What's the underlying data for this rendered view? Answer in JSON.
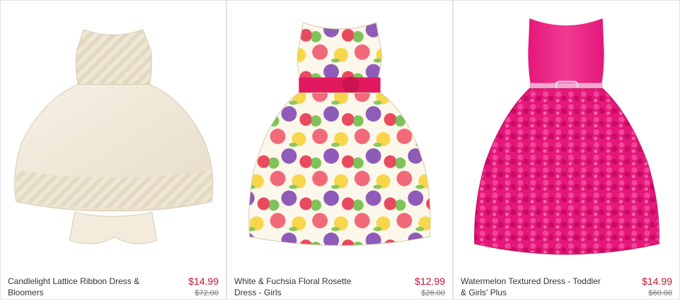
{
  "products": [
    {
      "name": "Candlelight Lattice Ribbon Dress & Bloomers",
      "price": "$14.99",
      "original_price": "$72.00",
      "image_icon": "dress-image"
    },
    {
      "name": "White & Fuchsia Floral Rosette Dress - Girls",
      "price": "$12.99",
      "original_price": "$26.00",
      "image_icon": "dress-image"
    },
    {
      "name": "Watermelon Textured Dress - Toddler & Girls' Plus",
      "price": "$14.99",
      "original_price": "$60.00",
      "image_icon": "dress-image"
    }
  ],
  "colors": {
    "price": "#c8102e",
    "border": "#e2e2e2",
    "text": "#333333"
  }
}
